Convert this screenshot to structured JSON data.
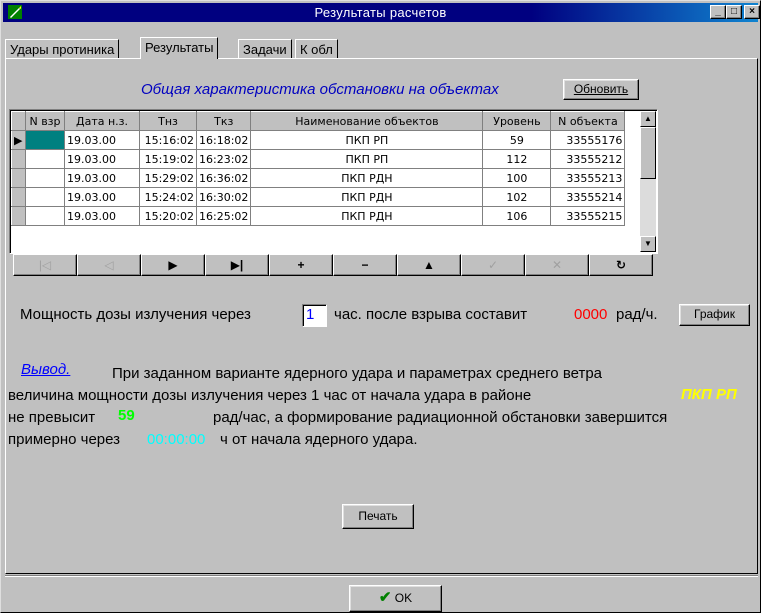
{
  "window": {
    "title": "Результаты расчетов",
    "controls": [
      "_",
      "□",
      "×"
    ]
  },
  "tabs": [
    {
      "label": "Удары протиника"
    },
    {
      "label": "Результаты"
    },
    {
      "label": "Задачи"
    },
    {
      "label": "К обл"
    }
  ],
  "section": {
    "title": "Общая характеристика обстановки на объектах",
    "refresh_label": "Обновить"
  },
  "grid": {
    "columns": [
      "N взр",
      "Дата н.з.",
      "Тнз",
      "Ткз",
      "Наименование объектов",
      "Уровень",
      "N объекта"
    ],
    "rows": [
      {
        "n": "",
        "date": "19.03.00",
        "tnz": "15:16:02",
        "tkz": "16:18:02",
        "name": "ПКП РП",
        "level": "59",
        "obj": "33555176"
      },
      {
        "n": "",
        "date": "19.03.00",
        "tnz": "15:19:02",
        "tkz": "16:23:02",
        "name": "ПКП РП",
        "level": "112",
        "obj": "33555212"
      },
      {
        "n": "",
        "date": "19.03.00",
        "tnz": "15:29:02",
        "tkz": "16:36:02",
        "name": "ПКП РДН",
        "level": "100",
        "obj": "33555213"
      },
      {
        "n": "",
        "date": "19.03.00",
        "tnz": "15:24:02",
        "tkz": "16:30:02",
        "name": "ПКП РДН",
        "level": "102",
        "obj": "33555214"
      },
      {
        "n": "",
        "date": "19.03.00",
        "tnz": "15:20:02",
        "tkz": "16:25:02",
        "name": "ПКП РДН",
        "level": "106",
        "obj": "33555215"
      }
    ]
  },
  "navigator": [
    {
      "glyph": "|◁",
      "icon": "first-record-icon"
    },
    {
      "glyph": "◁",
      "icon": "prior-record-icon"
    },
    {
      "glyph": "▶",
      "icon": "next-record-icon"
    },
    {
      "glyph": "▶|",
      "icon": "last-record-icon"
    },
    {
      "glyph": "+",
      "icon": "insert-icon"
    },
    {
      "glyph": "−",
      "icon": "delete-icon"
    },
    {
      "glyph": "▲",
      "icon": "edit-icon"
    },
    {
      "glyph": "✓",
      "icon": "post-icon"
    },
    {
      "glyph": "✕",
      "icon": "cancel-icon"
    },
    {
      "glyph": "↻",
      "icon": "refresh-icon"
    }
  ],
  "dose": {
    "prefix": "Мощность дозы излучения через",
    "hours_value": "1",
    "middle": "час. после взрыва составит",
    "result": "0000",
    "unit": "рад/ч.",
    "graph_label": "График"
  },
  "conclusion": {
    "heading": "Вывод.",
    "line1": "При заданном варианте ядерного удара и параметрах среднего ветра",
    "line2_prefix": "величина мощности дозы излучения через 1 час от начала удара в районе",
    "area": "ПКП РП",
    "line3_prefix": "не превысит",
    "max_value": "59",
    "line3_suffix": "рад/час, а формирование радиационной обстановки завершится",
    "line4_prefix": "примерно через",
    "time": "00:00:00",
    "line4_suffix": "ч  от начала ядерного удара."
  },
  "print_label": "Печать",
  "ok_label": "OK",
  "colors": {
    "title_bar": "#000080",
    "highlight_red": "#ff0000",
    "highlight_yellow": "#ffff00",
    "highlight_green": "#00ff00",
    "highlight_cyan": "#00ffff",
    "section_blue": "#0000c0"
  }
}
